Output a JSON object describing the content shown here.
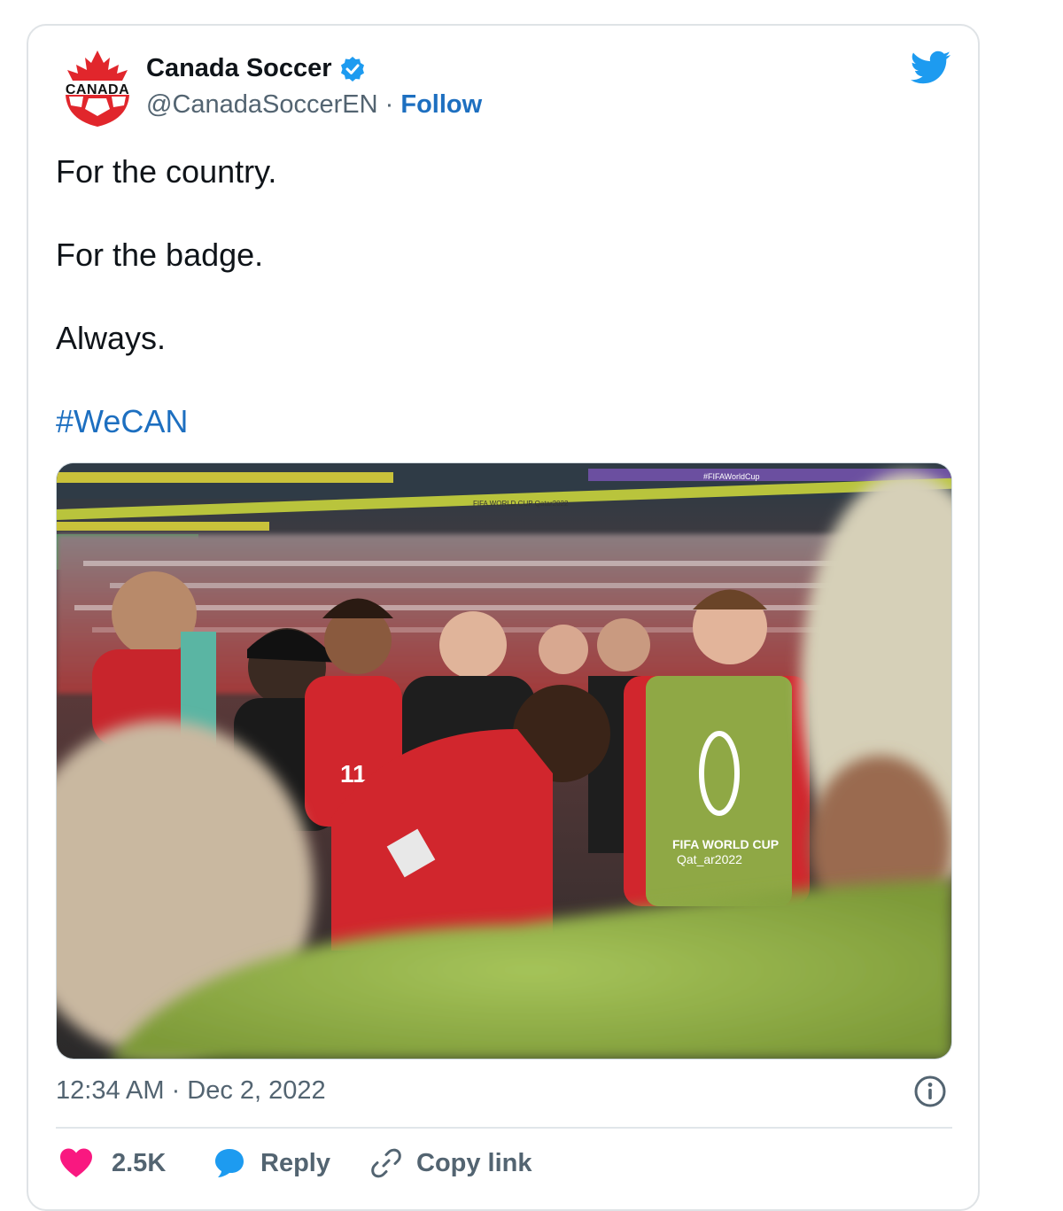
{
  "author": {
    "logo_text": "CANADA",
    "name": "Canada Soccer",
    "handle": "@CanadaSoccerEN",
    "separator": "·",
    "follow_label": "Follow"
  },
  "tweet": {
    "lines": [
      "For the country.",
      "For the badge.",
      "Always."
    ],
    "hashtag": "#WeCAN"
  },
  "media": {
    "banner_texts": [
      "FIFA WORLD CUP Qatar2022",
      "#FIFAWorldCup"
    ],
    "bib_text_1": "FIFA WORLD CUP",
    "bib_text_2": "Qat_ar2022",
    "shirt_number": "11"
  },
  "meta": {
    "timestamp": "12:34 AM · Dec 2, 2022"
  },
  "actions": {
    "likes_count": "2.5K",
    "reply_label": "Reply",
    "copy_link_label": "Copy link"
  },
  "colors": {
    "link": "#1d6fc0",
    "twitter_blue": "#1d9bf0",
    "like_red": "#f91880",
    "canada_red": "#e1262c"
  },
  "icons": [
    "twitter-bird-icon",
    "verified-badge-icon",
    "info-icon",
    "heart-icon",
    "reply-bubble-icon",
    "link-icon"
  ]
}
